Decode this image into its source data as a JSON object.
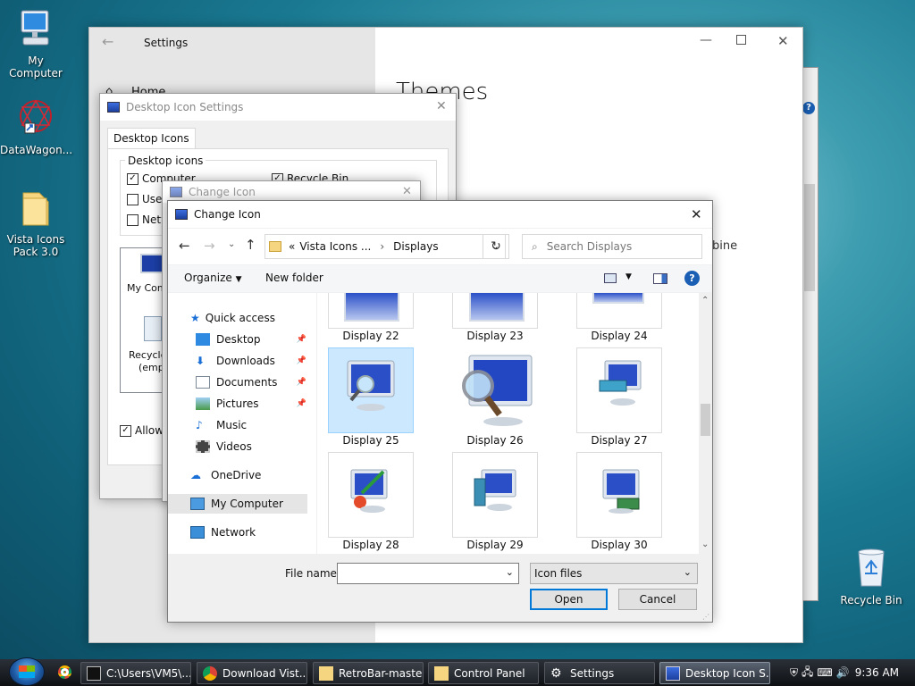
{
  "desktop": {
    "icons": [
      {
        "label": "My Computer"
      },
      {
        "label": "DataWagon..."
      },
      {
        "label": "Vista Icons Pack 3.0"
      },
      {
        "label": "Recycle Bin"
      }
    ]
  },
  "settings": {
    "title": "Settings",
    "nav_home": "Home",
    "heading": "Themes",
    "partial_text": "bine"
  },
  "desktop_icon_settings": {
    "title": "Desktop Icon Settings",
    "tab": "Desktop Icons",
    "group_label": "Desktop icons",
    "checkboxes": [
      {
        "label": "Computer",
        "checked": true
      },
      {
        "label": "Recycle Bin",
        "checked": true
      },
      {
        "label": "User",
        "checked": false
      },
      {
        "label": "Netw",
        "checked": false
      }
    ],
    "preview_items": [
      "My Comp",
      "Recycle",
      "(empt"
    ],
    "allow_label": "Allow t"
  },
  "change_icon_back": {
    "title": "Change Icon"
  },
  "file_dialog": {
    "title": "Change Icon",
    "path": {
      "prefix": "«",
      "segment1": "Vista Icons ...",
      "segment2": "Displays"
    },
    "search_placeholder": "Search Displays",
    "toolbar": {
      "organize": "Organize",
      "new_folder": "New folder",
      "help": "?"
    },
    "nav": [
      {
        "label": "Quick access",
        "pinned": false
      },
      {
        "label": "Desktop",
        "pinned": true
      },
      {
        "label": "Downloads",
        "pinned": true
      },
      {
        "label": "Documents",
        "pinned": true
      },
      {
        "label": "Pictures",
        "pinned": true
      },
      {
        "label": "Music",
        "pinned": false
      },
      {
        "label": "Videos",
        "pinned": false
      },
      {
        "label": "OneDrive",
        "pinned": false
      },
      {
        "label": "My Computer",
        "pinned": false
      },
      {
        "label": "Network",
        "pinned": false
      }
    ],
    "files": [
      {
        "label": "Display 22"
      },
      {
        "label": "Display 23"
      },
      {
        "label": "Display 24"
      },
      {
        "label": "Display 25",
        "selected": true
      },
      {
        "label": "Display 26"
      },
      {
        "label": "Display 27"
      },
      {
        "label": "Display 28"
      },
      {
        "label": "Display 29"
      },
      {
        "label": "Display 30"
      }
    ],
    "filename_label": "File name:",
    "filename_value": "",
    "filetype": "Icon files",
    "open": "Open",
    "cancel": "Cancel"
  },
  "taskbar": {
    "items": [
      {
        "label": "C:\\Users\\VM5\\..."
      },
      {
        "label": "Download Vist..."
      },
      {
        "label": "RetroBar-master"
      },
      {
        "label": "Control Panel"
      },
      {
        "label": "Settings"
      },
      {
        "label": "Desktop Icon S..."
      }
    ],
    "time": "9:36 AM"
  }
}
